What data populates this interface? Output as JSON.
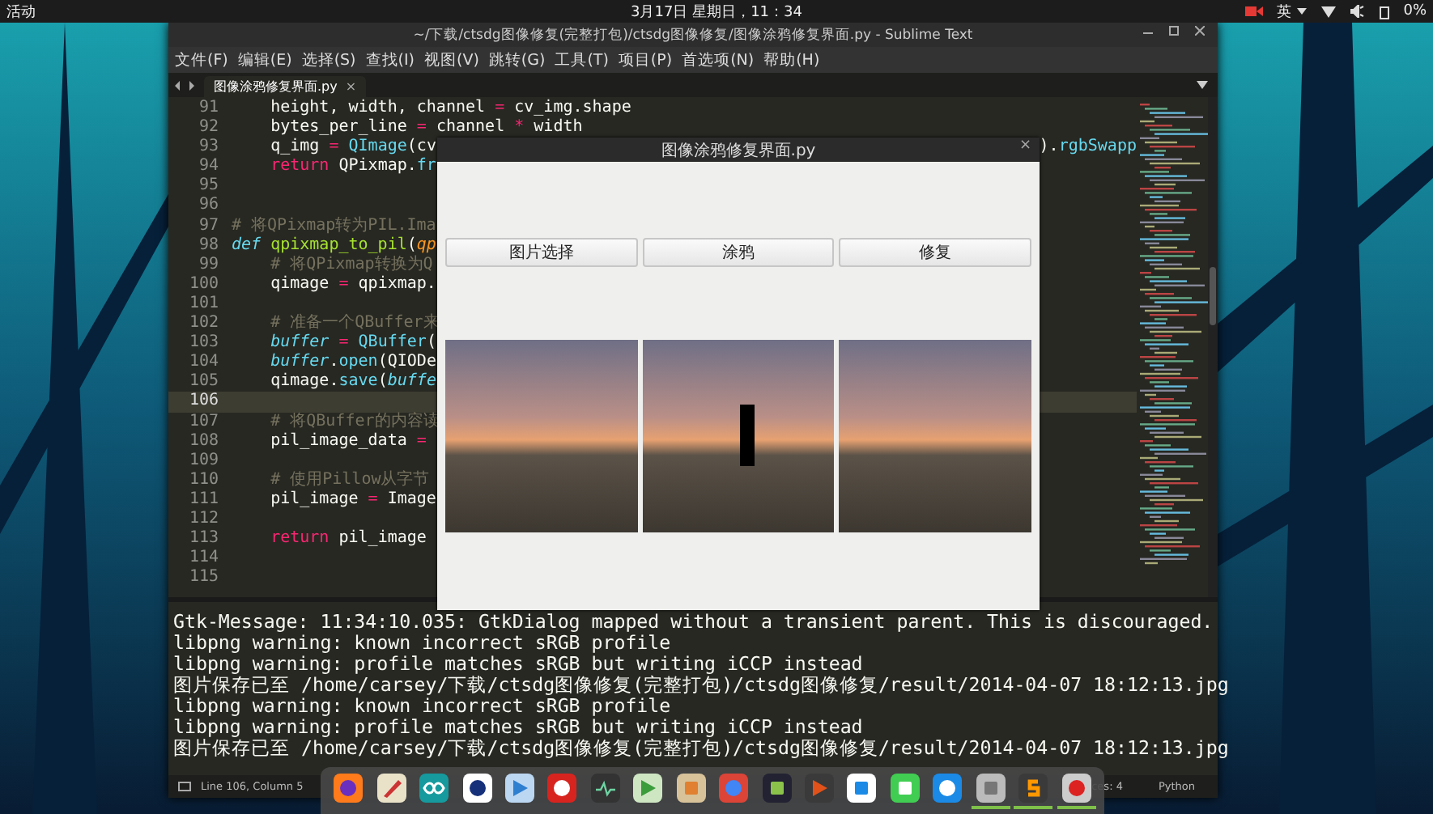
{
  "top_bar": {
    "activities": "活动",
    "clock": "3月17日 星期日，11：34",
    "input_method": "英",
    "battery": "0%"
  },
  "editor_window": {
    "title": "~/下载/ctsdg图像修复(完整打包)/ctsdg图像修复/图像涂鸦修复界面.py - Sublime Text",
    "menu": [
      "文件(F)",
      "编辑(E)",
      "选择(S)",
      "查找(I)",
      "视图(V)",
      "跳转(G)",
      "工具(T)",
      "项目(P)",
      "首选项(N)",
      "帮助(H)"
    ],
    "tabs": [
      {
        "label": "图像涂鸦修复界面.py",
        "close": "×",
        "selected": true
      }
    ],
    "code_lines": [
      {
        "number": "91",
        "current": false,
        "segments": [
          {
            "text": "    height, width, channel ",
            "kind": "plain"
          },
          {
            "text": "=",
            "kind": "operator"
          },
          {
            "text": " cv_img.shape",
            "kind": "plain"
          }
        ]
      },
      {
        "number": "92",
        "current": false,
        "segments": [
          {
            "text": "    bytes_per_line ",
            "kind": "plain"
          },
          {
            "text": "=",
            "kind": "operator"
          },
          {
            "text": " channel ",
            "kind": "plain"
          },
          {
            "text": "*",
            "kind": "operator"
          },
          {
            "text": " width",
            "kind": "plain"
          }
        ]
      },
      {
        "number": "93",
        "current": false,
        "segments": [
          {
            "text": "    q_img ",
            "kind": "plain"
          },
          {
            "text": "=",
            "kind": "operator"
          },
          {
            "text": " QImage",
            "kind": "builtin"
          },
          {
            "text": "(cv",
            "kind": "plain"
          }
        ],
        "tail": [
          {
            "text": ").",
            "kind": "plain"
          },
          {
            "text": "rgbSwapp",
            "kind": "builtin"
          }
        ]
      },
      {
        "number": "94",
        "current": false,
        "segments": [
          {
            "text": "    return",
            "kind": "keyword"
          },
          {
            "text": " QPixmap.",
            "kind": "plain"
          },
          {
            "text": "fr",
            "kind": "builtin"
          }
        ]
      },
      {
        "number": "95",
        "current": false
      },
      {
        "number": "96",
        "current": false
      },
      {
        "number": "97",
        "current": false,
        "segments": [
          {
            "text": "# 将QPixmap转为PIL.Ima",
            "kind": "comment"
          }
        ]
      },
      {
        "number": "98",
        "current": false,
        "segments": [
          {
            "text": "def",
            "kind": "storage"
          },
          {
            "text": " qpixmap_to_pil",
            "kind": "function"
          },
          {
            "text": "(",
            "kind": "plain"
          },
          {
            "text": "qp",
            "kind": "parameter"
          }
        ]
      },
      {
        "number": "99",
        "current": false,
        "segments": [
          {
            "text": "    # 将QPixmap转换为Q",
            "kind": "comment"
          }
        ]
      },
      {
        "number": "100",
        "current": false,
        "segments": [
          {
            "text": "    qimage ",
            "kind": "plain"
          },
          {
            "text": "=",
            "kind": "operator"
          },
          {
            "text": " qpixmap.",
            "kind": "plain"
          }
        ]
      },
      {
        "number": "101",
        "current": false
      },
      {
        "number": "102",
        "current": false,
        "segments": [
          {
            "text": "    # 准备一个QBuffer来",
            "kind": "comment"
          }
        ]
      },
      {
        "number": "103",
        "current": false,
        "segments": [
          {
            "text": "    buffer",
            "kind": "variable"
          },
          {
            "text": " =",
            "kind": "operator"
          },
          {
            "text": " QBuffer",
            "kind": "builtin"
          },
          {
            "text": "(",
            "kind": "plain"
          }
        ]
      },
      {
        "number": "104",
        "current": false,
        "segments": [
          {
            "text": "    buffer",
            "kind": "variable"
          },
          {
            "text": ".",
            "kind": "plain"
          },
          {
            "text": "open",
            "kind": "builtin"
          },
          {
            "text": "(QIODe",
            "kind": "plain"
          }
        ]
      },
      {
        "number": "105",
        "current": false,
        "segments": [
          {
            "text": "    qimage.",
            "kind": "plain"
          },
          {
            "text": "save",
            "kind": "builtin"
          },
          {
            "text": "(",
            "kind": "plain"
          },
          {
            "text": "buffe",
            "kind": "variable"
          }
        ]
      },
      {
        "number": "106",
        "current": true
      },
      {
        "number": "107",
        "current": false,
        "segments": [
          {
            "text": "    # 将QBuffer的内容读",
            "kind": "comment"
          }
        ]
      },
      {
        "number": "108",
        "current": false,
        "segments": [
          {
            "text": "    pil_image_data ",
            "kind": "plain"
          },
          {
            "text": "=",
            "kind": "operator"
          }
        ]
      },
      {
        "number": "109",
        "current": false
      },
      {
        "number": "110",
        "current": false,
        "segments": [
          {
            "text": "    # 使用Pillow从字节",
            "kind": "comment"
          }
        ]
      },
      {
        "number": "111",
        "current": false,
        "segments": [
          {
            "text": "    pil_image ",
            "kind": "plain"
          },
          {
            "text": "=",
            "kind": "operator"
          },
          {
            "text": " Image",
            "kind": "plain"
          }
        ]
      },
      {
        "number": "112",
        "current": false
      },
      {
        "number": "113",
        "current": false,
        "segments": [
          {
            "text": "    return",
            "kind": "keyword"
          },
          {
            "text": " pil_image",
            "kind": "plain"
          }
        ]
      },
      {
        "number": "114",
        "current": false
      },
      {
        "number": "115",
        "current": false
      }
    ],
    "console": [
      "Gtk-Message: 11:34:10.035: GtkDialog mapped without a transient parent. This is discouraged.",
      "libpng warning: known incorrect sRGB profile",
      "libpng warning: profile matches sRGB but writing iCCP instead",
      "图片保存已至 /home/carsey/下载/ctsdg图像修复(完整打包)/ctsdg图像修复/result/2014-04-07 18:12:13.jpg",
      "libpng warning: known incorrect sRGB profile",
      "libpng warning: profile matches sRGB but writing iCCP instead",
      "图片保存已至 /home/carsey/下载/ctsdg图像修复(完整打包)/ctsdg图像修复/result/2014-04-07 18:12:13.jpg"
    ],
    "status_bar": {
      "position": "Line 106, Column 5",
      "indentation": "ces: 4",
      "syntax": "Python"
    }
  },
  "dialog": {
    "title": "图像涂鸦修复界面.py",
    "close": "×",
    "buttons": [
      "图片选择",
      "涂鸦",
      "修复"
    ],
    "images": [
      {
        "scribbled": false
      },
      {
        "scribbled": true
      },
      {
        "scribbled": false
      }
    ]
  },
  "dock": {
    "apps": [
      {
        "running": false
      },
      {
        "running": false
      },
      {
        "running": false
      },
      {
        "running": false
      },
      {
        "running": false
      },
      {
        "running": false
      },
      {
        "running": false
      },
      {
        "running": false
      },
      {
        "running": false
      },
      {
        "running": false
      },
      {
        "running": false
      },
      {
        "running": false
      },
      {
        "running": false
      },
      {
        "running": false
      },
      {
        "running": false
      },
      {
        "running": true
      },
      {
        "running": true
      },
      {
        "running": true
      }
    ]
  }
}
